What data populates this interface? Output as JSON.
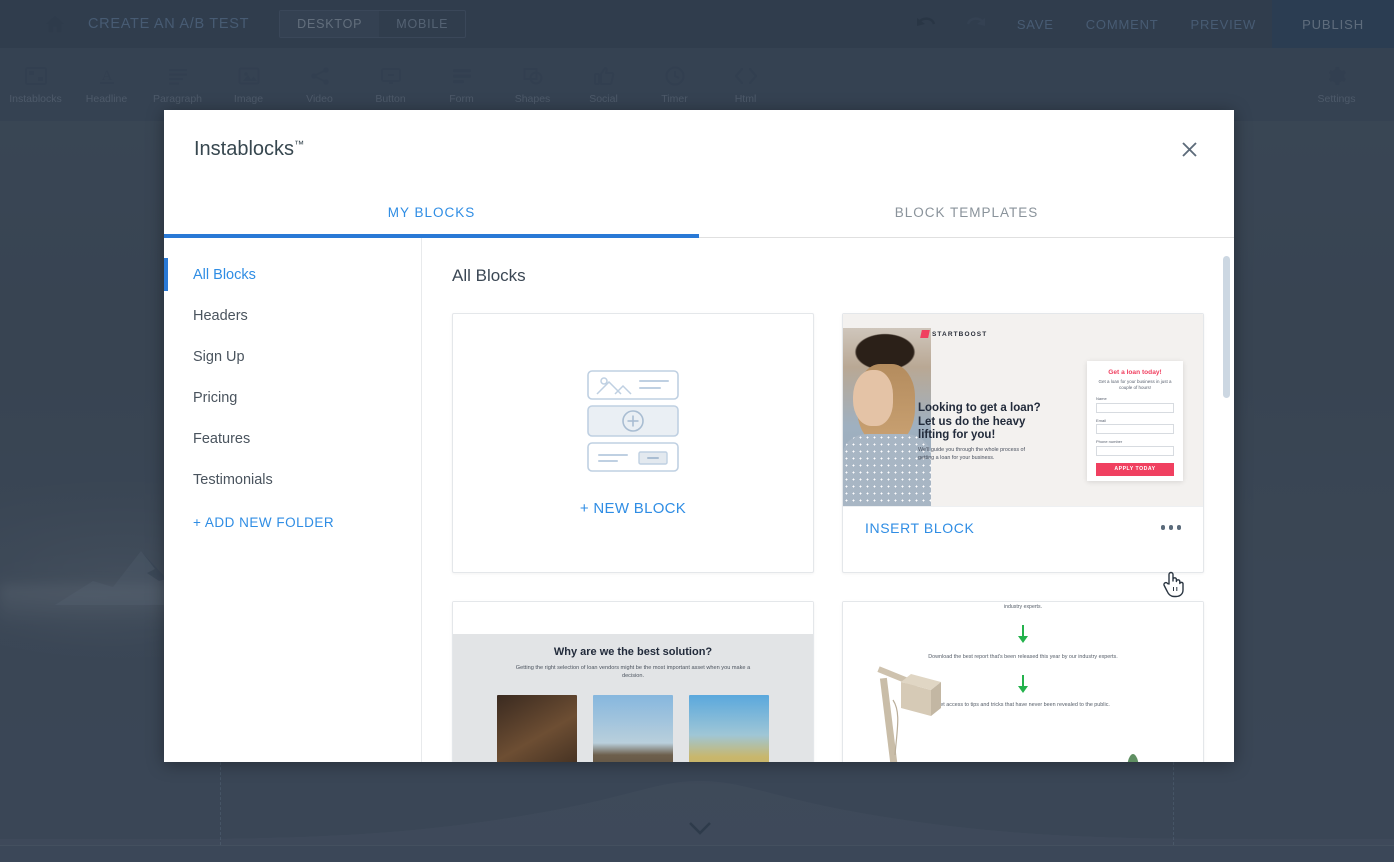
{
  "topbar": {
    "home_icon": "home-icon",
    "title": "CREATE AN A/B TEST",
    "device_desktop": "DESKTOP",
    "device_mobile": "MOBILE",
    "undo_icon": "undo-icon",
    "redo_icon": "redo-icon",
    "save": "SAVE",
    "comment": "COMMENT",
    "preview": "PREVIEW",
    "publish": "PUBLISH"
  },
  "toolbar": {
    "items": [
      {
        "label": "Instablocks",
        "icon": "instablocks-icon"
      },
      {
        "label": "Headline",
        "icon": "headline-icon"
      },
      {
        "label": "Paragraph",
        "icon": "paragraph-icon"
      },
      {
        "label": "Image",
        "icon": "image-icon"
      },
      {
        "label": "Video",
        "icon": "video-share-icon"
      },
      {
        "label": "Button",
        "icon": "button-icon"
      },
      {
        "label": "Form",
        "icon": "form-icon"
      },
      {
        "label": "Shapes",
        "icon": "shapes-icon"
      },
      {
        "label": "Social",
        "icon": "social-thumbsup-icon"
      },
      {
        "label": "Timer",
        "icon": "timer-clock-icon"
      },
      {
        "label": "Html",
        "icon": "html-code-icon"
      }
    ],
    "settings_label": "Settings",
    "settings_icon": "gear-icon"
  },
  "modal": {
    "title": "Instablocks",
    "title_tm": "™",
    "close_icon": "close-icon",
    "tabs": [
      {
        "label": "MY BLOCKS",
        "active": true
      },
      {
        "label": "BLOCK TEMPLATES",
        "active": false
      }
    ],
    "sidebar": {
      "items": [
        {
          "label": "All Blocks",
          "active": true
        },
        {
          "label": "Headers",
          "active": false
        },
        {
          "label": "Sign Up",
          "active": false
        },
        {
          "label": "Pricing",
          "active": false
        },
        {
          "label": "Features",
          "active": false
        },
        {
          "label": "Testimonials",
          "active": false
        }
      ],
      "add_folder": "+ ADD NEW FOLDER"
    },
    "content": {
      "heading": "All Blocks",
      "new_block_label": "+ NEW BLOCK",
      "new_block_icon": "block-stack-plus-icon",
      "insert_block_label": "INSERT BLOCK",
      "more_menu_icon": "more-horizontal-icon"
    }
  },
  "block_startboost": {
    "logo": "STARTBOOST",
    "headline": "Looking to get a loan? Let us do the heavy lifting for you!",
    "subtext": "We'll guide you through the whole process of getting a loan for your business.",
    "form_title": "Get a loan today!",
    "form_subtitle": "Get a loan for your business in just a couple of hours!",
    "fields": [
      "Name",
      "Email",
      "Phone number"
    ],
    "cta": "APPLY TODAY",
    "accent_color": "#f04060"
  },
  "block_why_best": {
    "headline": "Why are we the best solution?",
    "subtext": "Getting the right selection of loan vendors might be the most important asset when you make a decision."
  },
  "block_report": {
    "text_top": "industry experts.",
    "text_mid": "Download the best report that's been released this year by our industry experts.",
    "text_bottom": "Get access to tips and tricks that have never been revealed to the public.",
    "arrow_icon": "arrow-down-icon",
    "arrow_color": "#24b24c"
  },
  "canvas": {
    "scroll_chevron_icon": "chevron-down-icon"
  },
  "colors": {
    "accent_blue": "#2f8de4",
    "tab_underline": "#2979d6",
    "topbar_bg": "#3f4f63",
    "toolbar_bg": "#4d5c6e",
    "publish_bg": "#33506e"
  }
}
